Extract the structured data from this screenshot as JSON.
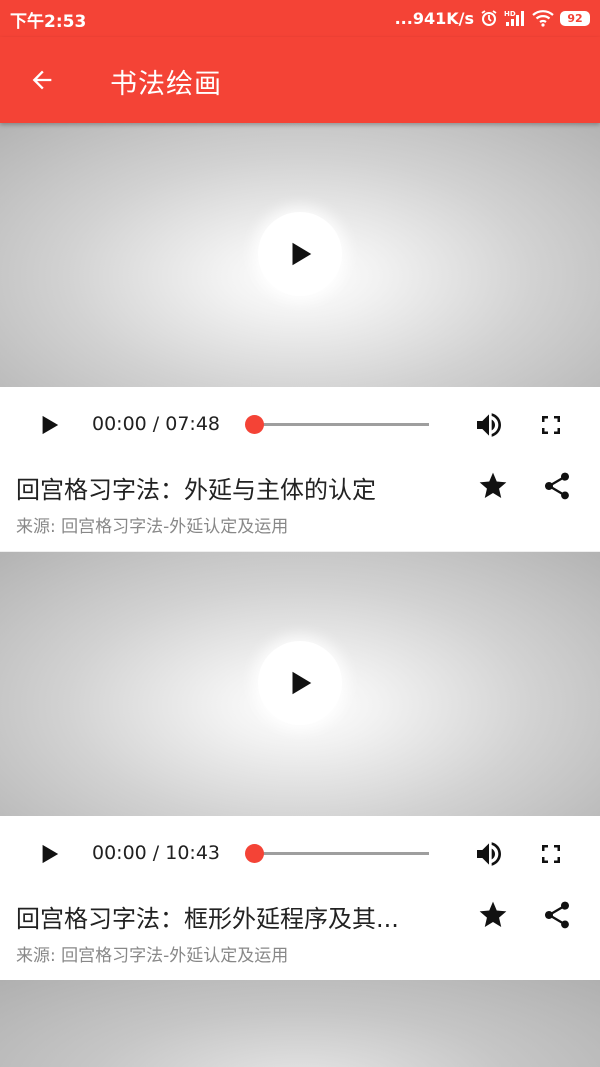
{
  "status_bar": {
    "time": "下午2:53",
    "network_speed": "...941K/s",
    "battery": "92"
  },
  "app_bar": {
    "title": "书法绘画",
    "back_icon": "arrow-back-icon"
  },
  "colors": {
    "primary": "#f44336",
    "accent": "#f44336",
    "progress_track": "#9e9e9e"
  },
  "videos": [
    {
      "time_display": "00:00 / 07:48",
      "progress": 0,
      "title": "回宫格习字法：外延与主体的认定",
      "source": "来源: 回宫格习字法-外延认定及运用"
    },
    {
      "time_display": "00:00 / 10:43",
      "progress": 0,
      "title": "回宫格习字法：框形外延程序及其...",
      "source": "来源: 回宫格习字法-外延认定及运用"
    }
  ]
}
